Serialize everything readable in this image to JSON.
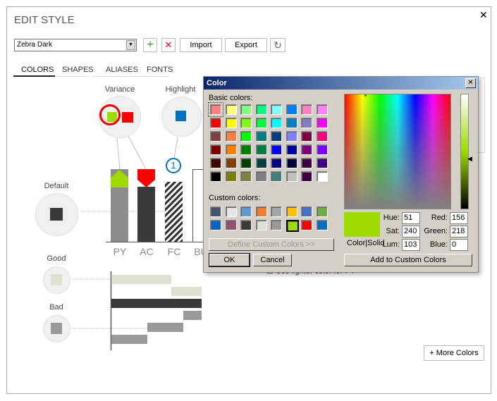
{
  "window": {
    "title": "EDIT STYLE",
    "close": "✕"
  },
  "toolbar": {
    "style_value": "Zebra Dark",
    "add": "+",
    "delete": "✕",
    "import": "Import",
    "export": "Export"
  },
  "tabs": [
    "COLORS",
    "SHAPES",
    "ALIASES",
    "FONTS"
  ],
  "preview": {
    "variance": "Variance",
    "highlight": "Highlight",
    "default": "Default",
    "good": "Good",
    "bad": "Bad",
    "highlight_marker": "1",
    "categories": [
      "PY",
      "AC",
      "FC",
      "BU"
    ],
    "lighter_py": "Use lighter color for PY",
    "more_colors": "+ More Colors",
    "colors": {
      "variance_good": "#9CDA00",
      "variance_bad": "#FF0000",
      "highlight": "#0070C0",
      "default": "#3A3A3A",
      "py": "#8C8C8C",
      "good": "#E0E0D0",
      "bad": "#999999"
    }
  },
  "dialog": {
    "title": "Color",
    "close": "✕",
    "basic_label": "Basic colors:",
    "custom_label": "Custom colors:",
    "basic_colors": [
      "#FF8080",
      "#FFFF80",
      "#80FF80",
      "#00FF80",
      "#80FFFF",
      "#0080FF",
      "#FF80C0",
      "#FF80FF",
      "#FF0000",
      "#FFFF00",
      "#80FF00",
      "#00FF40",
      "#00FFFF",
      "#0080C0",
      "#8080C0",
      "#FF00FF",
      "#804040",
      "#FF8040",
      "#00FF00",
      "#008080",
      "#004080",
      "#8080FF",
      "#800040",
      "#FF0080",
      "#800000",
      "#FF8000",
      "#008000",
      "#008040",
      "#0000FF",
      "#0000A0",
      "#800080",
      "#8000FF",
      "#400000",
      "#804000",
      "#004000",
      "#004040",
      "#000080",
      "#000040",
      "#400040",
      "#400080",
      "#000000",
      "#808000",
      "#808040",
      "#808080",
      "#408080",
      "#C0C0C0",
      "#400040",
      "#FFFFFF"
    ],
    "custom_colors": [
      "#44546A",
      "#E7E6E6",
      "#5B9BD5",
      "#ED7D31",
      "#A5A5A5",
      "#FFC000",
      "#4472C4",
      "#70AD47",
      "#0563C1",
      "#954F72",
      "#3A3A3A",
      "#E0E0D0",
      "#999999",
      "#9CDA00",
      "#FF0000",
      "#0070C0"
    ],
    "define_custom": "Define Custom Colors >>",
    "ok": "OK",
    "cancel": "Cancel",
    "color_solid": "Color|Solid",
    "add_custom": "Add to Custom Colors",
    "hue_label": "Hue:",
    "sat_label": "Sat:",
    "lum_label": "Lum:",
    "red_label": "Red:",
    "green_label": "Green:",
    "blue_label": "Blue:",
    "hue": "51",
    "sat": "240",
    "lum": "103",
    "red": "156",
    "green": "218",
    "blue": "0",
    "current_color": "#9CDA00"
  }
}
